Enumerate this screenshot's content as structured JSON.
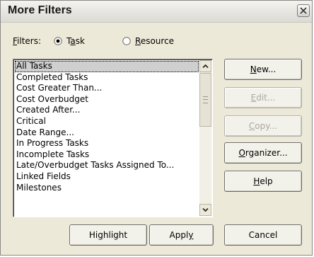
{
  "dialog": {
    "title": "More Filters"
  },
  "filters": {
    "label_underlined": "F",
    "label_rest": "ilters:",
    "options": [
      {
        "pre": "T",
        "u": "a",
        "post": "sk",
        "selected": true
      },
      {
        "pre": "",
        "u": "R",
        "post": "esource",
        "selected": false
      }
    ]
  },
  "list": {
    "items": [
      "All Tasks",
      "Completed Tasks",
      "Cost Greater Than...",
      "Cost Overbudget",
      "Created After...",
      "Critical",
      "Date Range...",
      "In Progress Tasks",
      "Incomplete Tasks",
      "Late/Overbudget Tasks Assigned To...",
      "Linked Fields",
      "Milestones"
    ],
    "selected_index": 0
  },
  "side_buttons": [
    {
      "pre": "",
      "u": "N",
      "post": "ew...",
      "enabled": true
    },
    {
      "pre": "",
      "u": "E",
      "post": "dit...",
      "enabled": false
    },
    {
      "pre": "",
      "u": "C",
      "post": "opy...",
      "enabled": false
    },
    {
      "pre": "",
      "u": "O",
      "post": "rganizer...",
      "enabled": true
    },
    {
      "pre": "",
      "u": "H",
      "post": "elp",
      "enabled": true
    }
  ],
  "bottom_buttons": [
    {
      "pre": "Hi",
      "u": "g",
      "post": "hlight"
    },
    {
      "pre": "Appl",
      "u": "y",
      "post": ""
    },
    {
      "pre": "Cancel",
      "u": "",
      "post": ""
    }
  ],
  "icons": {
    "close": "close-icon",
    "radio": "radio-icon",
    "scroll_up": "chevron-up-icon",
    "scroll_down": "chevron-down-icon"
  }
}
